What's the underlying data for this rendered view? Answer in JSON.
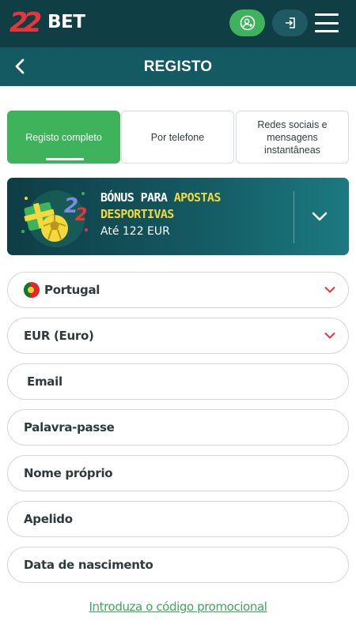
{
  "header": {
    "logo_number": "22",
    "logo_text": "BET",
    "profile_icon": "user-plus-icon",
    "login_icon": "sign-in-icon",
    "menu_icon": "hamburger-menu-icon"
  },
  "titlebar": {
    "title": "REGISTO",
    "back_icon": "chevron-left-icon"
  },
  "tabs": [
    {
      "label": "Registo completo",
      "active": true
    },
    {
      "label": "Por telefone",
      "active": false
    },
    {
      "label": "Redes sociais e mensagens instantâneas",
      "active": false
    }
  ],
  "bonus": {
    "title_white": "BÓNUS PARA",
    "title_yellow_1": "APOSTAS",
    "title_yellow_2": "DESPORTIVAS",
    "subtitle": "Até 122 EUR",
    "toggle_icon": "chevron-down-icon"
  },
  "form": {
    "country": "Portugal",
    "currency": "EUR (Euro)",
    "email_placeholder": "Email",
    "password_placeholder": "Palavra-passe",
    "first_name_placeholder": "Nome próprio",
    "last_name_placeholder": "Apelido",
    "birth_date_placeholder": "Data de nascimento"
  },
  "promo_link": "Introduza o código promocional",
  "colors": {
    "header_bg": "#0f3e45",
    "titlebar_bg": "#135a62",
    "accent_green": "#3fb35c",
    "brand_red": "#e8353b",
    "bonus_yellow": "#f3d93b"
  }
}
